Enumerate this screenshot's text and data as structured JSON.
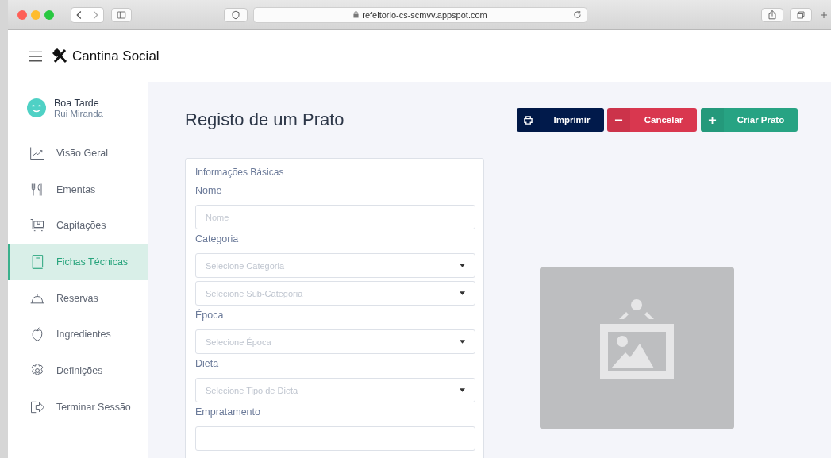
{
  "browser": {
    "url": "refeitorio-cs-scmvv.appspot.com"
  },
  "app": {
    "title": "Cantina Social"
  },
  "sidebar": {
    "greeting": "Boa Tarde",
    "user": "Rui Miranda",
    "items": [
      {
        "label": "Visão Geral",
        "selected": false
      },
      {
        "label": "Ementas",
        "selected": false
      },
      {
        "label": "Capitações",
        "selected": false
      },
      {
        "label": "Fichas Técnicas",
        "selected": true
      },
      {
        "label": "Reservas",
        "selected": false
      },
      {
        "label": "Ingredientes",
        "selected": false
      },
      {
        "label": "Definições",
        "selected": false
      },
      {
        "label": "Terminar Sessão",
        "selected": false
      }
    ]
  },
  "page": {
    "title": "Registo de um Prato"
  },
  "buttons": [
    {
      "kind": "print",
      "label": "Imprimir"
    },
    {
      "kind": "cancel",
      "label": "Cancelar"
    },
    {
      "kind": "create",
      "label": "Criar Prato"
    }
  ],
  "form": {
    "section": "Informações Básicas",
    "fields": [
      {
        "kind": "text",
        "label": "Nome",
        "placeholder": "Nome"
      },
      {
        "kind": "select",
        "label": "Categoria",
        "placeholder": "Selecione Categoria"
      },
      {
        "kind": "select",
        "placeholder": "Selecione Sub-Categoria"
      },
      {
        "kind": "select",
        "label": "Época",
        "placeholder": "Selecione Época"
      },
      {
        "kind": "select",
        "label": "Dieta",
        "placeholder": "Selecione Tipo de Dieta"
      },
      {
        "kind": "cut",
        "label": "Empratamento"
      }
    ]
  }
}
